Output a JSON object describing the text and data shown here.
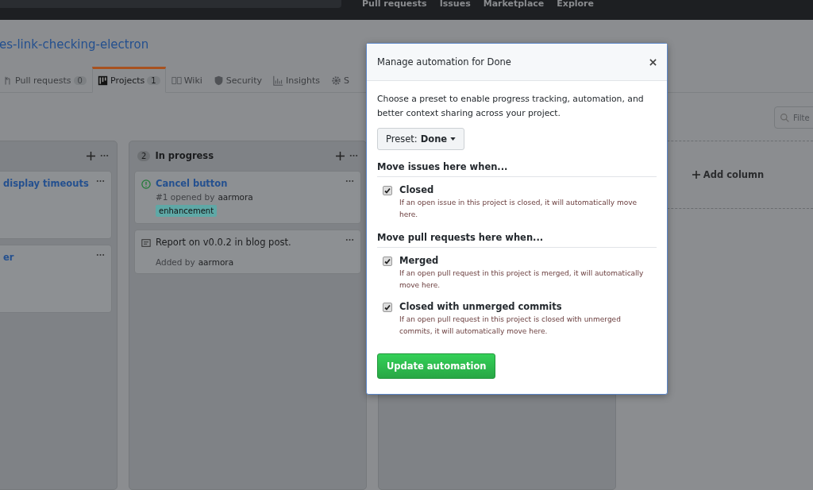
{
  "header": {
    "nav": [
      "Pull requests",
      "Issues",
      "Marketplace",
      "Explore"
    ]
  },
  "repo": {
    "title": "es-link-checking-electron"
  },
  "tabs": [
    {
      "label": "Pull requests",
      "count": "0",
      "selected": false
    },
    {
      "label": "Projects",
      "count": "1",
      "selected": true
    },
    {
      "label": "Wiki",
      "selected": false
    },
    {
      "label": "Security",
      "selected": false
    },
    {
      "label": "Insights",
      "selected": false
    },
    {
      "label": "S",
      "selected": false
    }
  ],
  "filter": {
    "placeholder": "Filte"
  },
  "columns": [
    {
      "cards": [
        {
          "kind": "title",
          "title": "display timeouts"
        },
        {
          "kind": "title",
          "title": "er"
        }
      ]
    },
    {
      "count": "2",
      "title": "In progress",
      "cards": [
        {
          "kind": "issue",
          "title": "Cancel button",
          "meta": "#1 opened by",
          "author": "aarmora",
          "labels": [
            {
              "name": "enhancement",
              "color": "#5fa8a6"
            }
          ]
        },
        {
          "kind": "note",
          "title": "Report on v0.0.2 in blog post.",
          "meta": "Added by",
          "author": "aarmora"
        }
      ]
    },
    {}
  ],
  "add_column": "Add column",
  "modal": {
    "title": "Manage automation for Done",
    "description": "Choose a preset to enable progress tracking, automation, and better context sharing across your project.",
    "preset": {
      "label": "Preset:",
      "value": "Done"
    },
    "sections": [
      {
        "heading": "Move issues here when...",
        "options": [
          {
            "label": "Closed",
            "description": "If an open issue in this project is closed, it will automatically move here.",
            "checked": true
          }
        ]
      },
      {
        "heading": "Move pull requests here when...",
        "options": [
          {
            "label": "Merged",
            "description": "If an open pull request in this project is merged, it will automatically move here.",
            "checked": true
          },
          {
            "label": "Closed with unmerged commits",
            "description": "If an open pull request in this project is closed with unmerged commits, it will automatically move here.",
            "checked": true
          }
        ]
      }
    ],
    "submit": "Update automation"
  }
}
